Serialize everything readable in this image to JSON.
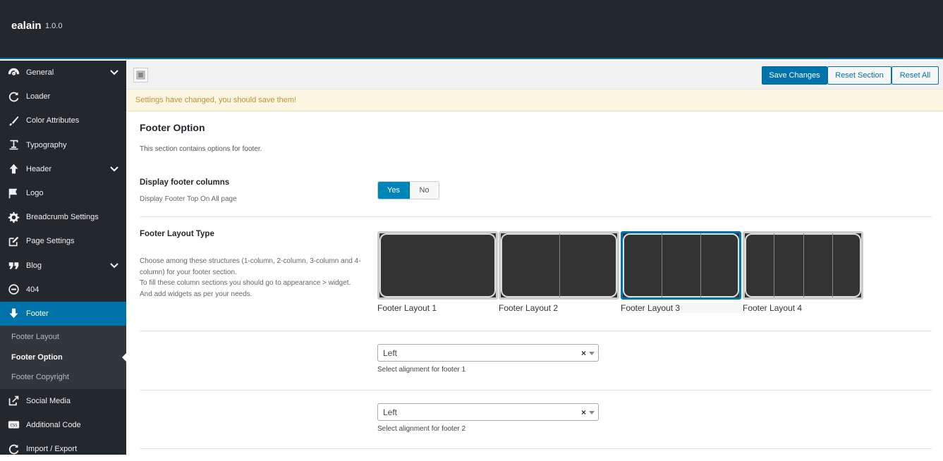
{
  "app": {
    "name": "ealain",
    "version": "1.0.0"
  },
  "sidebar": {
    "items": [
      {
        "label": "General",
        "icon": "dashboard-icon",
        "has_children": true
      },
      {
        "label": "Loader",
        "icon": "refresh-icon",
        "has_children": false
      },
      {
        "label": "Color Attributes",
        "icon": "brush-icon",
        "has_children": false
      },
      {
        "label": "Typography",
        "icon": "text-icon",
        "has_children": false
      },
      {
        "label": "Header",
        "icon": "arrow-up-icon",
        "has_children": true
      },
      {
        "label": "Logo",
        "icon": "flag-icon",
        "has_children": false
      },
      {
        "label": "Breadcrumb Settings",
        "icon": "gear-icon",
        "has_children": false
      },
      {
        "label": "Page Settings",
        "icon": "edit-icon",
        "has_children": false
      },
      {
        "label": "Blog",
        "icon": "quote-icon",
        "has_children": true
      },
      {
        "label": "404",
        "icon": "minus-circle-icon",
        "has_children": false
      },
      {
        "label": "Footer",
        "icon": "arrow-down-icon",
        "has_children": false,
        "active": true
      }
    ],
    "footer_sub": [
      "Footer Layout",
      "Footer Option",
      "Footer Copyright"
    ],
    "bottom_items": [
      {
        "label": "Social Media",
        "icon": "share-icon"
      },
      {
        "label": "Additional Code",
        "icon": "css-icon"
      },
      {
        "label": "Import / Export",
        "icon": "refresh-icon"
      }
    ]
  },
  "toolbar": {
    "save": "Save Changes",
    "reset_section": "Reset Section",
    "reset_all": "Reset All"
  },
  "notice": "Settings have changed, you should save them!",
  "section": {
    "title": "Footer Option",
    "description": "This section contains options for footer."
  },
  "display_columns": {
    "label": "Display footer columns",
    "sub": "Display Footer Top On All page",
    "yes": "Yes",
    "no": "No",
    "value": "Yes"
  },
  "layout_type": {
    "label": "Footer Layout Type",
    "sub": "Choose among these structures (1-column, 2-column, 3-column and 4-column) for your footer section.\nTo fill these column sections you should go to appearance > widget.\nAnd add widgets as per your needs.",
    "options": [
      "Footer Layout 1",
      "Footer Layout 2",
      "Footer Layout 3",
      "Footer Layout 4"
    ],
    "selected": "Footer Layout 3"
  },
  "alignments": [
    {
      "value": "Left",
      "help": "Select alignment for footer 1"
    },
    {
      "value": "Left",
      "help": "Select alignment for footer 2"
    }
  ],
  "colors": {
    "accent": "#0073aa",
    "sidebar": "#23282d",
    "notice_bg": "#fbf5e2"
  }
}
